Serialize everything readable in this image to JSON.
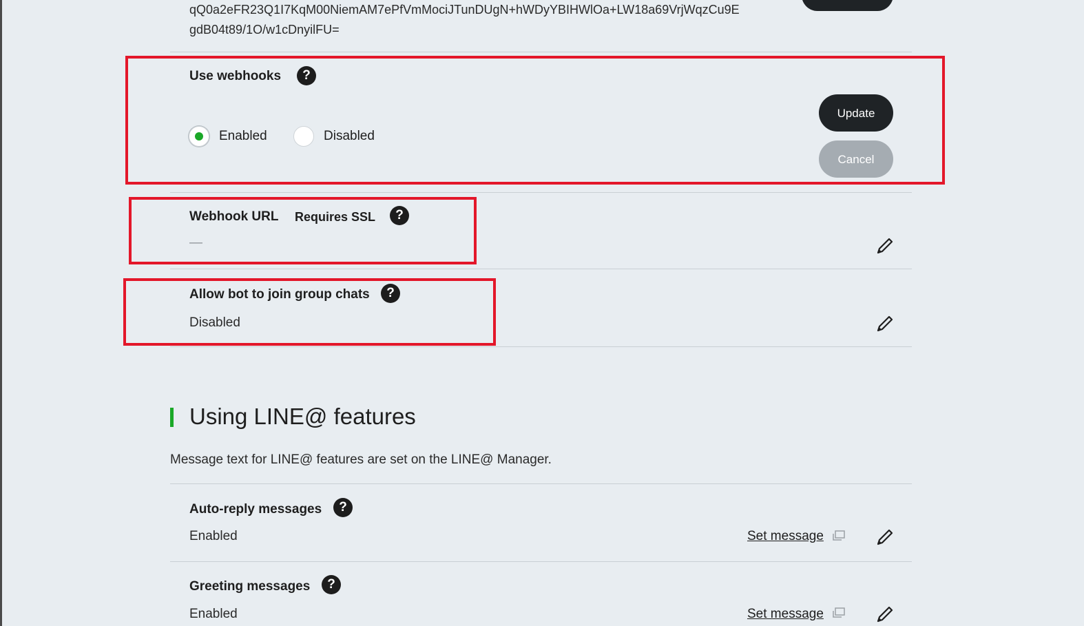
{
  "channel_secret": {
    "line1": "qQ0a2eFR23Q1I7KqM00NiemAM7ePfVmMociJTunDUgN+hWDyYBIHWlOa+LW18a69VrjWqzCu9E",
    "line2": "gdB04t89/1O/w1cDnyilFU="
  },
  "webhooks": {
    "label": "Use webhooks",
    "help": "?",
    "options": [
      {
        "label": "Enabled",
        "selected": true
      },
      {
        "label": "Disabled",
        "selected": false
      }
    ],
    "update_label": "Update",
    "cancel_label": "Cancel"
  },
  "webhook_url": {
    "label": "Webhook URL",
    "sublabel": "Requires SSL",
    "help": "?",
    "value": "—"
  },
  "group_chats": {
    "label": "Allow bot to join group chats",
    "help": "?",
    "value": "Disabled"
  },
  "line_features": {
    "title": "Using LINE@ features",
    "description": "Message text for LINE@ features are set on the LINE@ Manager.",
    "items": [
      {
        "label": "Auto-reply messages",
        "help": "?",
        "value": "Enabled",
        "link": "Set message"
      },
      {
        "label": "Greeting messages",
        "help": "?",
        "value": "Enabled",
        "link": "Set message"
      }
    ]
  },
  "colors": {
    "accent": "#1aa828",
    "highlight": "#e3172a",
    "dark_button": "#1f2326",
    "cancel_button": "#a5acb2",
    "background": "#e8edf1"
  },
  "icons": {
    "help": "question-circle-icon",
    "edit": "pencil-icon",
    "external": "external-window-icon"
  }
}
